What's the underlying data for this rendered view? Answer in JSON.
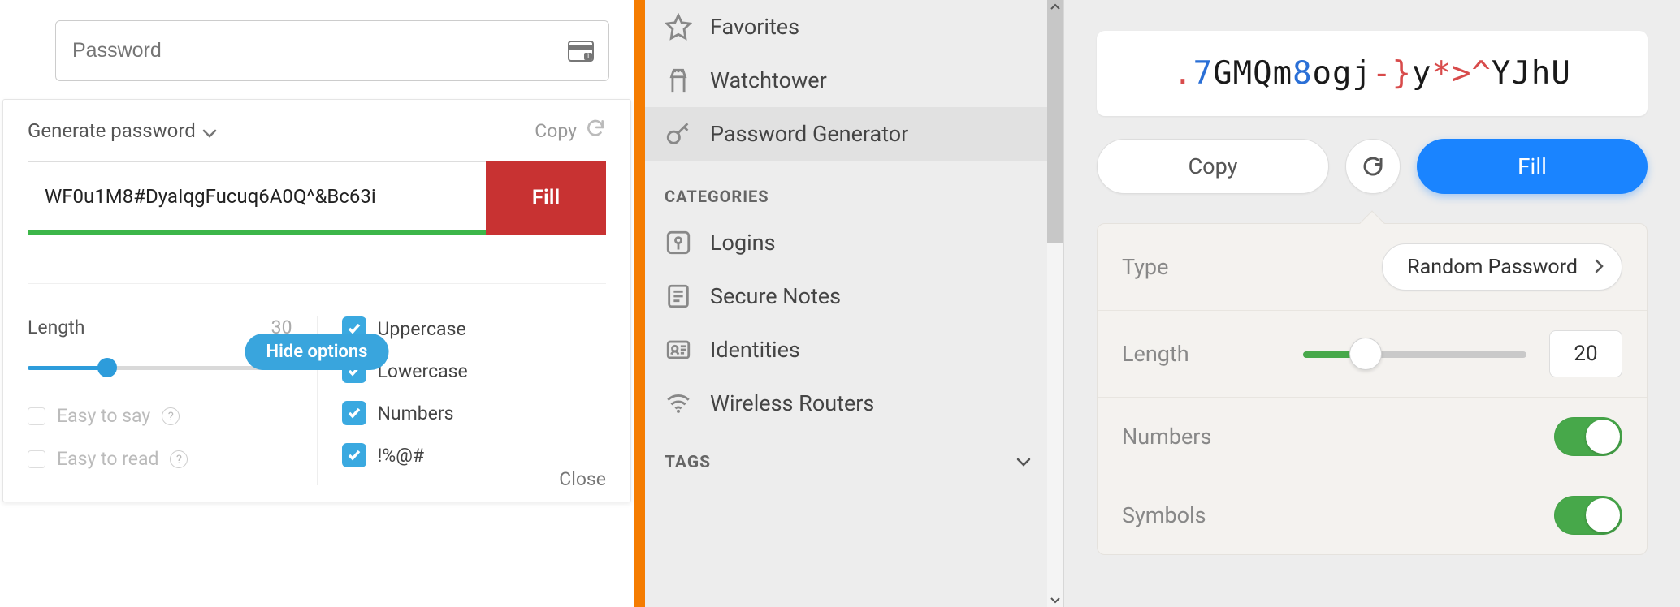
{
  "left": {
    "password_placeholder": "Password",
    "title": "Generate password",
    "copy_label": "Copy",
    "generated_password": "WF0u1M8#DyaIqgFucuq6A0Q^&Bc63i",
    "fill_label": "Fill",
    "hide_options_label": "Hide options",
    "length_label": "Length",
    "length_value": "30",
    "easy_to_say": "Easy to say",
    "easy_to_read": "Easy to read",
    "opt_uppercase": "Uppercase",
    "opt_lowercase": "Lowercase",
    "opt_numbers": "Numbers",
    "opt_symbols": "!%@#",
    "close_label": "Close"
  },
  "mid": {
    "items_top": [
      {
        "label": "Favorites",
        "icon": "star-icon"
      },
      {
        "label": "Watchtower",
        "icon": "tower-icon"
      },
      {
        "label": "Password Generator",
        "icon": "key-icon"
      }
    ],
    "categories_label": "CATEGORIES",
    "items_categories": [
      {
        "label": "Logins",
        "icon": "key-box-icon"
      },
      {
        "label": "Secure Notes",
        "icon": "note-icon"
      },
      {
        "label": "Identities",
        "icon": "id-icon"
      },
      {
        "label": "Wireless Routers",
        "icon": "wifi-icon"
      }
    ],
    "tags_label": "TAGS"
  },
  "right": {
    "generated_password": ".7GMQm8ogj-}y*>^YJhU",
    "copy_label": "Copy",
    "fill_label": "Fill",
    "type_label": "Type",
    "type_value": "Random Password",
    "length_label": "Length",
    "length_value": "20",
    "numbers_label": "Numbers",
    "symbols_label": "Symbols",
    "numbers_on": true,
    "symbols_on": true
  }
}
